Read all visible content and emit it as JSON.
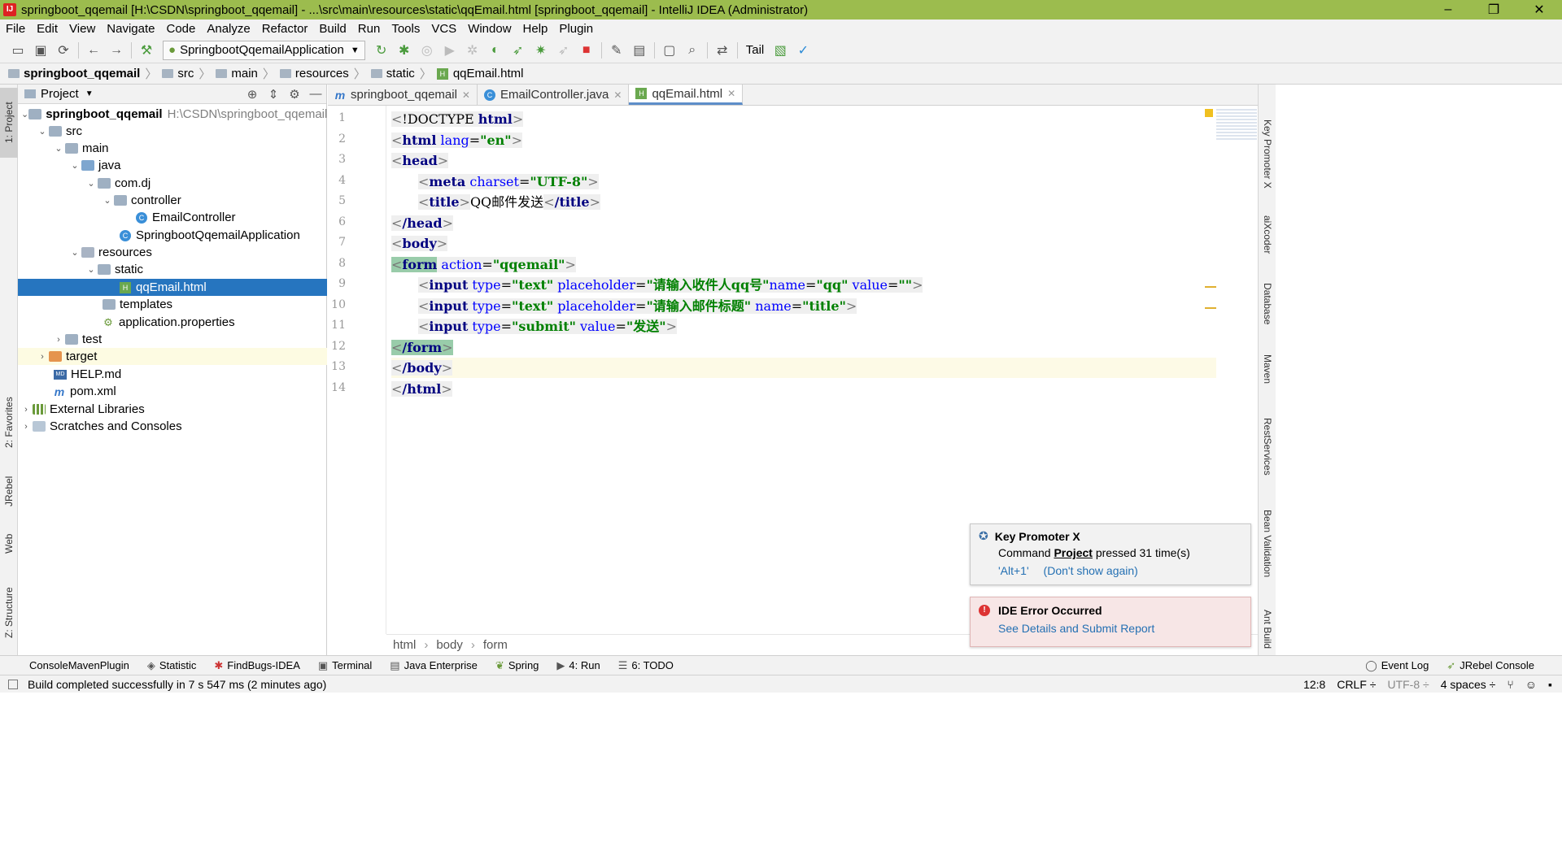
{
  "window": {
    "title": "springboot_qqemail [H:\\CSDN\\springboot_qqemail] - ...\\src\\main\\resources\\static\\qqEmail.html [springboot_qqemail] - IntelliJ IDEA (Administrator)",
    "app_icon_text": "IJ"
  },
  "menu": [
    "File",
    "Edit",
    "View",
    "Navigate",
    "Code",
    "Analyze",
    "Refactor",
    "Build",
    "Run",
    "Tools",
    "VCS",
    "Window",
    "Help",
    "Plugin"
  ],
  "toolbar": {
    "run_config": "SpringbootQqemailApplication",
    "tail_label": "Tail"
  },
  "navbar": {
    "crumbs": [
      "springboot_qqemail",
      "src",
      "main",
      "resources",
      "static",
      "qqEmail.html"
    ]
  },
  "left_strip": {
    "project": "1: Project",
    "favorites": "2: Favorites",
    "jrebel": "JRebel",
    "web": "Web",
    "structure": "Z: Structure"
  },
  "right_strip": {
    "key_promoter": "Key Promoter X",
    "aixcoder": "aiXcoder",
    "database": "Database",
    "maven": "Maven",
    "rest": "RestServices",
    "bean": "Bean Validation",
    "ant": "Ant Build"
  },
  "project_panel": {
    "header": "Project",
    "tree": [
      {
        "label": "springboot_qqemail",
        "extra": "H:\\CSDN\\springboot_qqemail"
      },
      {
        "label": "src"
      },
      {
        "label": "main"
      },
      {
        "label": "java"
      },
      {
        "label": "com.dj"
      },
      {
        "label": "controller"
      },
      {
        "label": "EmailController"
      },
      {
        "label": "SpringbootQqemailApplication"
      },
      {
        "label": "resources"
      },
      {
        "label": "static"
      },
      {
        "label": "qqEmail.html"
      },
      {
        "label": "templates"
      },
      {
        "label": "application.properties"
      },
      {
        "label": "test"
      },
      {
        "label": "target"
      },
      {
        "label": "HELP.md"
      },
      {
        "label": "pom.xml"
      },
      {
        "label": "External Libraries"
      },
      {
        "label": "Scratches and Consoles"
      }
    ]
  },
  "editor": {
    "tabs": [
      "springboot_qqemail",
      "EmailController.java",
      "qqEmail.html"
    ],
    "line_numbers": [
      "1",
      "2",
      "3",
      "4",
      "5",
      "6",
      "7",
      "8",
      "9",
      "10",
      "11",
      "12",
      "13",
      "14"
    ],
    "lines": {
      "l1": {
        "open": "<",
        "tag": "!DOCTYPE",
        "attr": "html",
        "close": ">"
      },
      "l2": {
        "tag": "html",
        "attr": "lang",
        "value": "\"en\""
      },
      "l3": {
        "tag": "head"
      },
      "l4": {
        "tag": "meta",
        "attr": "charset",
        "value": "\"UTF-8\""
      },
      "l5": {
        "tag": "title",
        "text": "QQ邮件发送",
        "endtag": "/title"
      },
      "l6": {
        "tag": "/head"
      },
      "l7": {
        "tag": "body"
      },
      "l8": {
        "tag": "form",
        "attr": "action",
        "value": "\"qqemail\""
      },
      "l9": {
        "tag": "input",
        "a1": "type",
        "v1": "\"text\"",
        "a2": "placeholder",
        "v2": "\"请输入收件人qq号\"",
        "a3": "name",
        "v3": "\"qq\"",
        "a4": "value",
        "v4": "\"\""
      },
      "l10": {
        "tag": "input",
        "a1": "type",
        "v1": "\"text\"",
        "a2": "placeholder",
        "v2": "\"请输入邮件标题\"",
        "a3": "name",
        "v3": "\"title\""
      },
      "l11": {
        "tag": "input",
        "a1": "type",
        "v1": "\"submit\"",
        "a2": "value",
        "v2": "\"发送\""
      },
      "l12": {
        "tag": "/form"
      },
      "l13": {
        "tag": "/body"
      },
      "l14": {
        "tag": "/html"
      }
    },
    "breadcrumb": [
      "html",
      "body",
      "form"
    ]
  },
  "popups": {
    "key_promoter": {
      "title": "Key Promoter X",
      "msg_prefix": "Command ",
      "msg_bold": "Project",
      "msg_suffix": " pressed 31 time(s)",
      "shortcut": "'Alt+1'",
      "dismiss": "(Don't show again)"
    },
    "ide_error": {
      "title": "IDE Error Occurred",
      "link": "See Details and Submit Report"
    }
  },
  "bottom_tabs": {
    "console_maven": "ConsoleMavenPlugin",
    "statistic": "Statistic",
    "findbugs": "FindBugs-IDEA",
    "terminal": "Terminal",
    "java_ee": "Java Enterprise",
    "spring": "Spring",
    "run": "4: Run",
    "todo": "6: TODO",
    "event_log": "Event Log",
    "jrebel_console": "JRebel Console"
  },
  "status": {
    "message": "Build completed successfully in 7 s 547 ms (2 minutes ago)",
    "position": "12:8",
    "line_sep": "CRLF ÷",
    "encoding": "UTF-8 ÷",
    "indent": "4 spaces ÷"
  },
  "colors": {
    "titlebar": "#9cbc4e",
    "selection": "#2675bf",
    "tag": "#000080",
    "attr": "#0000ff",
    "string": "#008000"
  }
}
